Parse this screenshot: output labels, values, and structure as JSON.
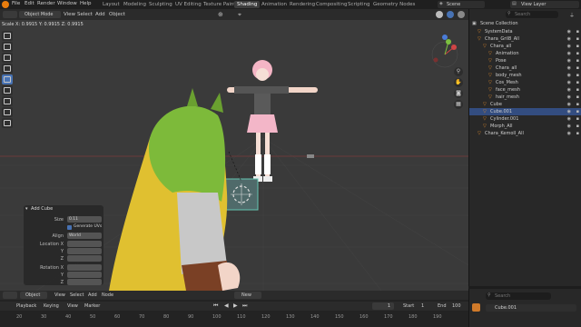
{
  "menu": [
    "File",
    "Edit",
    "Render",
    "Window",
    "Help"
  ],
  "workspaces": [
    "Layout",
    "Modeling",
    "Sculpting",
    "UV Editing",
    "Texture Paint",
    "Shading",
    "Animation",
    "Rendering",
    "Compositing",
    "Scripting",
    "Geometry Nodes"
  ],
  "active_workspace": "Shading",
  "scene": "Scene",
  "view_layer": "View Layer",
  "header": {
    "mode": "Object Mode",
    "view": "View",
    "select": "Select",
    "add": "Add",
    "object": "Object"
  },
  "scale_readout": "Scale X: 0.9915  Y: 0.9915  Z: 0.9915",
  "operator_panel": {
    "title": "Add Cube",
    "size_label": "Size",
    "size_value": "0.11",
    "generate_uvs": "Generate UVs",
    "align_label": "Align",
    "align_value": "World",
    "location_label": "Location X",
    "y_label": "Y",
    "z_label": "Z",
    "rotation_label": "Rotation X",
    "ry_label": "Y",
    "rz_label": "Z"
  },
  "outliner": {
    "search_placeholder": "Search",
    "root": "Scene Collection",
    "items": [
      {
        "label": "SystemData",
        "indent": 1
      },
      {
        "label": "Chara_Gril8_All",
        "indent": 1
      },
      {
        "label": "Chara_all",
        "indent": 2
      },
      {
        "label": "Animation",
        "indent": 3
      },
      {
        "label": "Pose",
        "indent": 3
      },
      {
        "label": "Chara_all",
        "indent": 3
      },
      {
        "label": "body_mesh",
        "indent": 3
      },
      {
        "label": "Cos_Mesh",
        "indent": 3
      },
      {
        "label": "face_mesh",
        "indent": 3
      },
      {
        "label": "hair_mesh",
        "indent": 3
      },
      {
        "label": "Cube",
        "indent": 2
      },
      {
        "label": "Cube.001",
        "indent": 2,
        "selected": true
      },
      {
        "label": "Cylinder.001",
        "indent": 2
      },
      {
        "label": "Morph_All",
        "indent": 2
      },
      {
        "label": "Chara_Kemoll_All",
        "indent": 1
      }
    ]
  },
  "properties": {
    "search_placeholder": "Search",
    "object_name": "Cube.001"
  },
  "timeline": {
    "header": [
      "Object",
      "View",
      "Select",
      "Add",
      "Node"
    ],
    "new_label": "New",
    "playback": "Playback",
    "keying": "Keying",
    "view": "View",
    "marker": "Marker",
    "current_frame": "1",
    "start_label": "Start",
    "start": "1",
    "end_label": "End",
    "end": "100",
    "ticks": [
      "20",
      "30",
      "40",
      "50",
      "60",
      "70",
      "80",
      "90",
      "100",
      "110",
      "120",
      "130",
      "140",
      "150",
      "160",
      "170",
      "180",
      "190"
    ]
  },
  "colors": {
    "accent": "#4772b3",
    "selection": "#334d80",
    "viewport": "#3a3a3a",
    "active_tab": "#3d3d3d"
  }
}
